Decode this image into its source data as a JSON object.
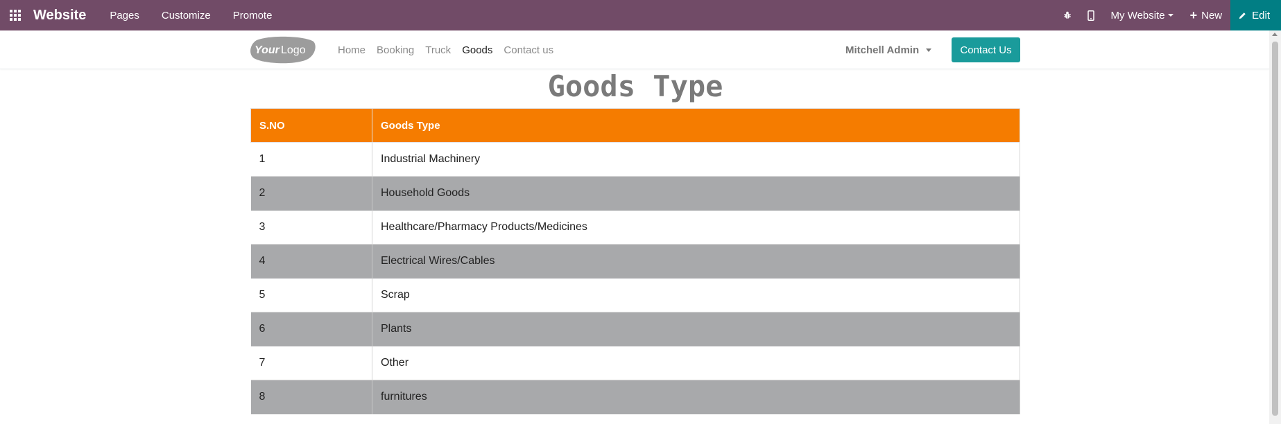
{
  "admin_bar": {
    "brand": "Website",
    "menu": [
      "Pages",
      "Customize",
      "Promote"
    ],
    "website_selector": "My Website",
    "new_label": "New",
    "edit_label": "Edit"
  },
  "header": {
    "logo_text": "YourLogo",
    "nav": [
      "Home",
      "Booking",
      "Truck",
      "Goods",
      "Contact us"
    ],
    "active_nav": "Goods",
    "user_name": "Mitchell Admin",
    "contact_button": "Contact Us"
  },
  "content": {
    "title": "Goods Type",
    "table": {
      "headers": [
        "S.NO",
        "Goods Type"
      ],
      "rows": [
        [
          "1",
          "Industrial Machinery"
        ],
        [
          "2",
          "Household Goods"
        ],
        [
          "3",
          "Healthcare/Pharmacy Products/Medicines"
        ],
        [
          "4",
          "Electrical Wires/Cables"
        ],
        [
          "5",
          "Scrap"
        ],
        [
          "6",
          "Plants"
        ],
        [
          "7",
          "Other"
        ],
        [
          "8",
          "furnitures"
        ]
      ]
    }
  },
  "colors": {
    "admin_bar": "#714B67",
    "edit_button": "#017E84",
    "contact_button": "#1A9B9B",
    "table_header": "#F57C00",
    "row_striped": "#A8A9AB"
  },
  "icons": {
    "apps": "apps-grid-icon",
    "debug": "bug-icon",
    "mobile": "mobile-icon",
    "new": "plus-icon",
    "edit": "pencil-icon"
  }
}
